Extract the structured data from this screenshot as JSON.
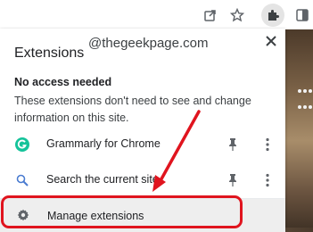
{
  "colors": {
    "accent_red": "#e0141e",
    "grammarly_green": "#15c39a",
    "popup_bg": "#ffffff",
    "manage_bg": "#eeeeee"
  },
  "toolbar": {
    "icons": [
      "share-icon",
      "star-icon",
      "extensions-puzzle-icon",
      "sidebar-icon"
    ]
  },
  "popup": {
    "title": "Extensions",
    "watermark": "@thegeekpage.com",
    "close_label": "✕",
    "section": {
      "heading": "No access needed",
      "description": "These extensions don't need to see and change information on this site."
    },
    "extensions": [
      {
        "name": "Grammarly for Chrome",
        "icon": "grammarly-icon"
      },
      {
        "name": "Search the current site",
        "icon": "search-icon"
      }
    ],
    "manage_label": "Manage extensions"
  }
}
